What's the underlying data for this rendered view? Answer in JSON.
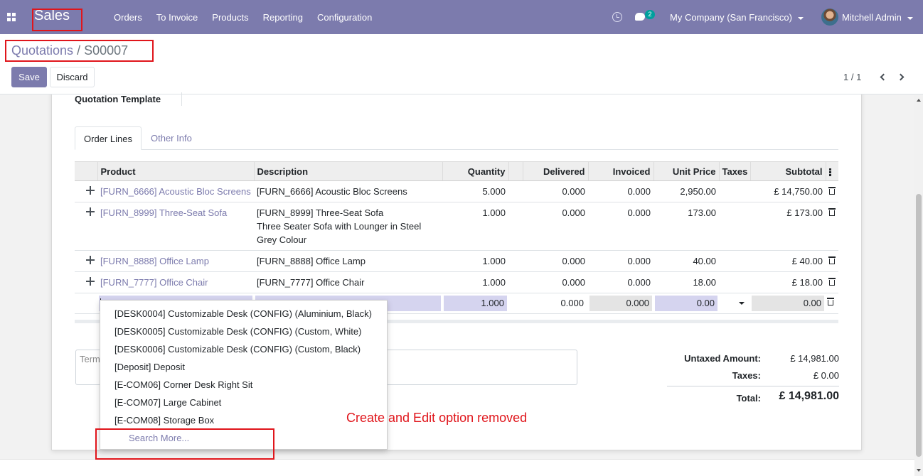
{
  "navbar": {
    "app_name": "Sales",
    "menu": [
      "Orders",
      "To Invoice",
      "Products",
      "Reporting",
      "Configuration"
    ],
    "chat_count": "2",
    "company": "My Company (San Francisco)",
    "user": "Mitchell Admin"
  },
  "breadcrumb": {
    "parent": "Quotations",
    "separator": "/",
    "current": "S00007"
  },
  "buttons": {
    "save": "Save",
    "discard": "Discard"
  },
  "pager": {
    "value": "1 / 1"
  },
  "form": {
    "quotation_template_label": "Quotation Template",
    "tabs": [
      "Order Lines",
      "Other Info"
    ]
  },
  "table": {
    "headers": [
      "Product",
      "Description",
      "Quantity",
      "Delivered",
      "Invoiced",
      "Unit Price",
      "Taxes",
      "Subtotal"
    ],
    "rows": [
      {
        "product": "[FURN_6666] Acoustic Bloc Screens",
        "description": [
          "[FURN_6666] Acoustic Bloc Screens"
        ],
        "quantity": "5.000",
        "delivered": "0.000",
        "invoiced": "0.000",
        "unit_price": "2,950.00",
        "taxes": "",
        "subtotal": "£ 14,750.00"
      },
      {
        "product": "[FURN_8999] Three-Seat Sofa",
        "description": [
          "[FURN_8999] Three-Seat Sofa",
          "Three Seater Sofa with Lounger in Steel",
          "Grey Colour"
        ],
        "quantity": "1.000",
        "delivered": "0.000",
        "invoiced": "0.000",
        "unit_price": "173.00",
        "taxes": "",
        "subtotal": "£ 173.00"
      },
      {
        "product": "[FURN_8888] Office Lamp",
        "description": [
          "[FURN_8888] Office Lamp"
        ],
        "quantity": "1.000",
        "delivered": "0.000",
        "invoiced": "0.000",
        "unit_price": "40.00",
        "taxes": "",
        "subtotal": "£ 40.00"
      },
      {
        "product": "[FURN_7777] Office Chair",
        "description": [
          "[FURN_7777] Office Chair"
        ],
        "quantity": "1.000",
        "delivered": "0.000",
        "invoiced": "0.000",
        "unit_price": "18.00",
        "taxes": "",
        "subtotal": "£ 18.00"
      }
    ],
    "edit_row": {
      "product": "",
      "description": "",
      "quantity": "1.000",
      "delivered": "0.000",
      "invoiced": "0.000",
      "unit_price": "0.00",
      "subtotal": "0.00"
    }
  },
  "dropdown": {
    "items": [
      "[DESK0004] Customizable Desk (CONFIG) (Aluminium, Black)",
      "[DESK0005] Customizable Desk (CONFIG) (Custom, White)",
      "[DESK0006] Customizable Desk (CONFIG) (Custom, Black)",
      "[Deposit] Deposit",
      "[E-COM06] Corner Desk Right Sit",
      "[E-COM07] Large Cabinet",
      "[E-COM08] Storage Box"
    ],
    "search_more": "Search More..."
  },
  "terms": {
    "placeholder": "Term"
  },
  "totals": {
    "untaxed_label": "Untaxed Amount:",
    "untaxed_value": "£ 14,981.00",
    "taxes_label": "Taxes:",
    "taxes_value": "£ 0.00",
    "total_label": "Total:",
    "total_value": "£ 14,981.00"
  },
  "annotation": {
    "text": "Create and Edit option removed"
  },
  "colors": {
    "brand": "#7c7bad",
    "annotation_red": "#e0151b",
    "edit_field": "#d5d4ef"
  }
}
